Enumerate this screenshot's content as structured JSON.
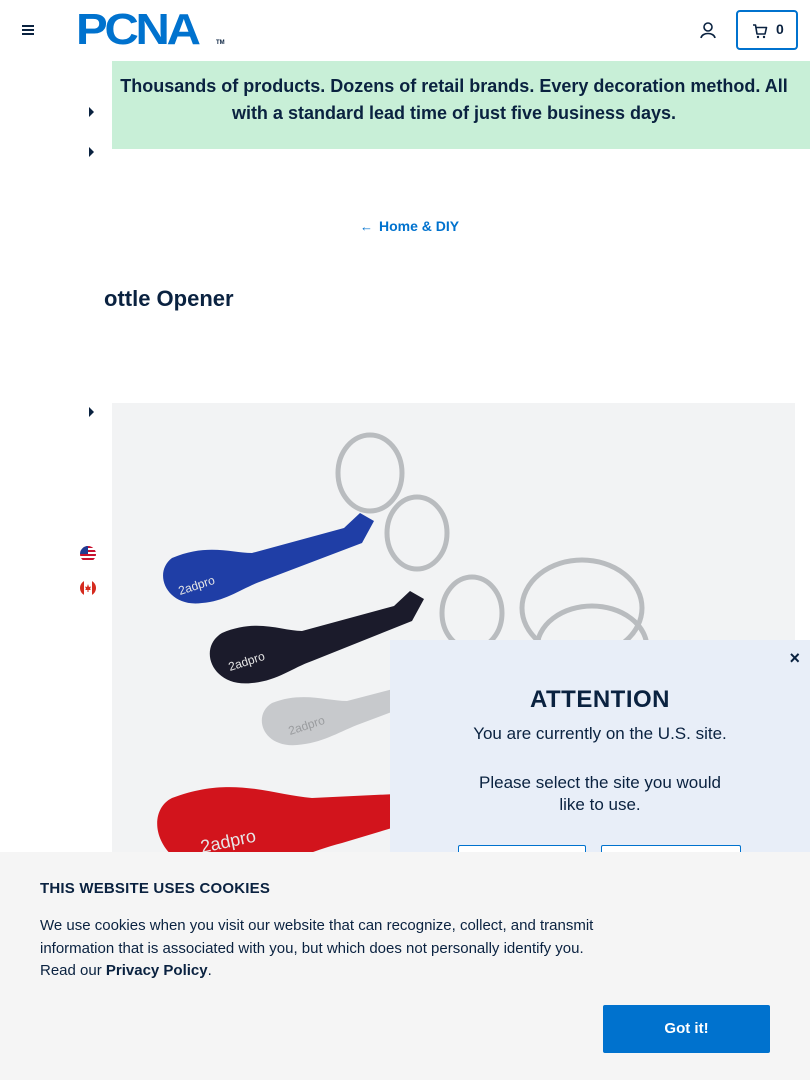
{
  "header": {
    "logo_text": "PCNA",
    "logo_tm": "TM",
    "cart_count": "0"
  },
  "banner": {
    "text": "Thousands of products. Dozens of retail brands. Every decoration method. All with a standard lead time of just five business days."
  },
  "breadcrumb": {
    "arrow": "←",
    "label": "Home & DIY"
  },
  "product": {
    "title": "ottle Opener",
    "image_text_1": "2adpro",
    "image_text_2": "2adpro",
    "image_text_3": "2adpro",
    "image_text_4": "2adpro"
  },
  "modal": {
    "close": "×",
    "title": "ATTENTION",
    "line1": "You are currently on the U.S. site.",
    "line2": "Please select the site you would",
    "line3": "like to use."
  },
  "cookie": {
    "title": "THIS WEBSITE USES COOKIES",
    "body": "We use cookies when you visit our website that can recognize, collect, and transmit information that is associated with you, but which does not personally identify you. Read our ",
    "link": "Privacy Policy",
    "period": ".",
    "button": "Got it!"
  },
  "colors": {
    "brand_blue": "#0072ce",
    "navy": "#0a2240",
    "banner_green": "#c8efd7",
    "modal_bg": "#e8eef8"
  },
  "icons": [
    "menu-icon",
    "account-icon",
    "cart-icon",
    "close-icon",
    "us-flag-icon",
    "canada-flag-icon",
    "caret-right-icon"
  ]
}
